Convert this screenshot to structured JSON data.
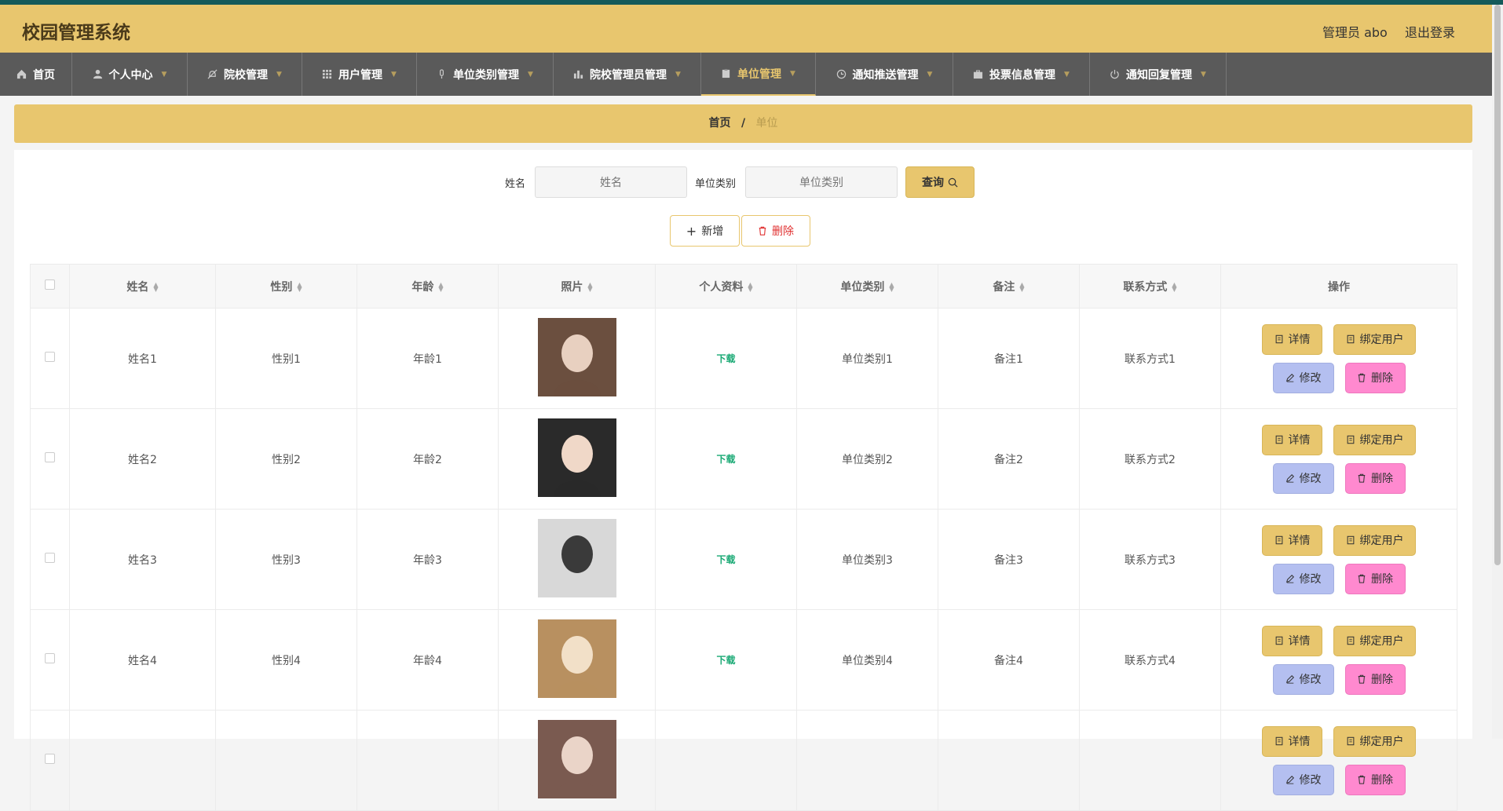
{
  "header": {
    "title": "校园管理系统",
    "user": "管理员 abo",
    "logout": "退出登录"
  },
  "nav": [
    {
      "label": "首页",
      "icon": "home-icon",
      "has_caret": false
    },
    {
      "label": "个人中心",
      "icon": "user-icon",
      "has_caret": true
    },
    {
      "label": "院校管理",
      "icon": "bell-off-icon",
      "has_caret": true
    },
    {
      "label": "用户管理",
      "icon": "grid-icon",
      "has_caret": true
    },
    {
      "label": "单位类别管理",
      "icon": "microphone-icon",
      "has_caret": true
    },
    {
      "label": "院校管理员管理",
      "icon": "bar-chart-icon",
      "has_caret": true
    },
    {
      "label": "单位管理",
      "icon": "clipboard-icon",
      "has_caret": true,
      "active": true
    },
    {
      "label": "通知推送管理",
      "icon": "clock-icon",
      "has_caret": true
    },
    {
      "label": "投票信息管理",
      "icon": "briefcase-icon",
      "has_caret": true
    },
    {
      "label": "通知回复管理",
      "icon": "power-icon",
      "has_caret": true
    }
  ],
  "breadcrumb": {
    "home": "首页",
    "separator": "/",
    "current": "单位"
  },
  "search": {
    "name_label": "姓名",
    "name_placeholder": "姓名",
    "category_label": "单位类别",
    "category_placeholder": "单位类别",
    "query_label": "查询"
  },
  "actions": {
    "add_label": "新增",
    "delete_label": "删除"
  },
  "table": {
    "columns": [
      "姓名",
      "性别",
      "年龄",
      "照片",
      "个人资料",
      "单位类别",
      "备注",
      "联系方式",
      "操作"
    ],
    "rows": [
      {
        "name": "姓名1",
        "gender": "性别1",
        "age": "年龄1",
        "file": "下载",
        "category": "单位类别1",
        "note": "备注1",
        "contact": "联系方式1"
      },
      {
        "name": "姓名2",
        "gender": "性别2",
        "age": "年龄2",
        "file": "下载",
        "category": "单位类别2",
        "note": "备注2",
        "contact": "联系方式2"
      },
      {
        "name": "姓名3",
        "gender": "性别3",
        "age": "年龄3",
        "file": "下载",
        "category": "单位类别3",
        "note": "备注3",
        "contact": "联系方式3"
      },
      {
        "name": "姓名4",
        "gender": "性别4",
        "age": "年龄4",
        "file": "下载",
        "category": "单位类别4",
        "note": "备注4",
        "contact": "联系方式4"
      },
      {
        "name": "",
        "gender": "",
        "age": "",
        "file": "",
        "category": "",
        "note": "",
        "contact": ""
      }
    ],
    "op_labels": {
      "detail": "详情",
      "bind": "绑定用户",
      "edit": "修改",
      "remove": "删除"
    }
  },
  "colors": {
    "accent": "#e8c66e",
    "nav_bg": "#5a5a5a",
    "top_stripe": "#145a5a",
    "edit": "#b4bff0",
    "remove": "#ff89cf",
    "download": "#19a974"
  }
}
